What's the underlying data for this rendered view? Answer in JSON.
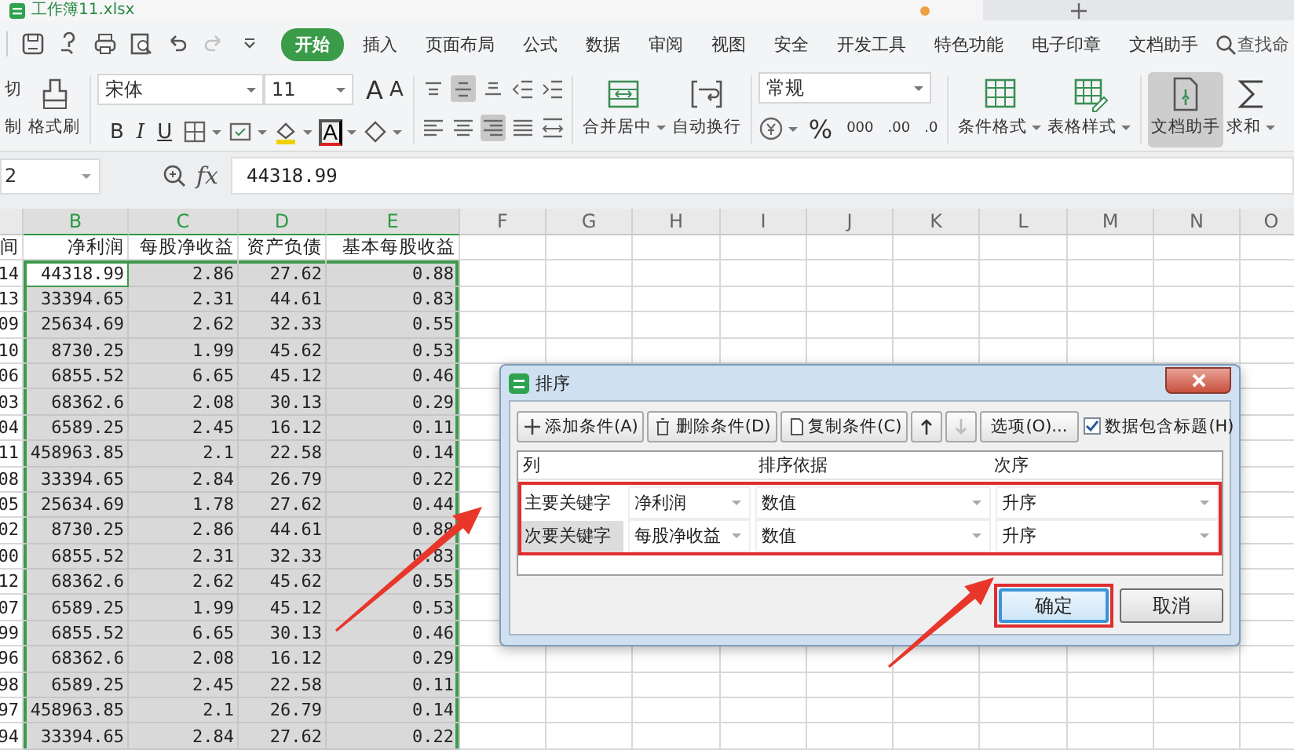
{
  "document_tab": {
    "title": "工作簿11.xlsx",
    "unsaved": true
  },
  "quick_access": [
    {
      "kind": "save",
      "disabled": false
    },
    {
      "kind": "format",
      "disabled": false
    },
    {
      "kind": "print",
      "disabled": false
    },
    {
      "kind": "preview",
      "disabled": false
    },
    {
      "kind": "undo",
      "disabled": false
    },
    {
      "kind": "redo",
      "disabled": true
    },
    {
      "kind": "customize",
      "disabled": false
    }
  ],
  "menu": {
    "tabs": [
      {
        "label": "开始",
        "selected": true
      },
      {
        "label": "插入",
        "selected": false
      },
      {
        "label": "页面布局",
        "selected": false
      },
      {
        "label": "公式",
        "selected": false
      },
      {
        "label": "数据",
        "selected": false
      },
      {
        "label": "审阅",
        "selected": false
      },
      {
        "label": "视图",
        "selected": false
      },
      {
        "label": "安全",
        "selected": false
      },
      {
        "label": "开发工具",
        "selected": false
      },
      {
        "label": "特色功能",
        "selected": false
      },
      {
        "label": "电子印章",
        "selected": false
      },
      {
        "label": "文档助手",
        "selected": false
      }
    ],
    "search": "查找命"
  },
  "ribbon": {
    "clipboard": {
      "cut": "切",
      "copy": "制",
      "format_painter": "格式刷"
    },
    "font": {
      "name": "宋体",
      "size": "11",
      "grow": "A",
      "shrink": "A",
      "bold": "B",
      "italic": "I",
      "underline": "U",
      "font_color": "A"
    },
    "alignment": [
      {
        "kind": "top",
        "selected": false
      },
      {
        "kind": "middle",
        "selected": true
      },
      {
        "kind": "bottom",
        "selected": false
      },
      {
        "kind": "outdent",
        "selected": false
      },
      {
        "kind": "indent",
        "selected": false
      },
      {
        "kind": "left",
        "selected": false
      },
      {
        "kind": "center",
        "selected": false
      },
      {
        "kind": "right",
        "selected": true
      },
      {
        "kind": "justify",
        "selected": false
      },
      {
        "kind": "distributed",
        "selected": false
      }
    ],
    "merge": "合并居中",
    "wrap": "自动换行",
    "number": {
      "format": "常规",
      "percent": "%",
      "thousands": "000",
      "increase_decimal": ".00",
      "decrease_decimal": ".0"
    },
    "tools": [
      {
        "kind": "conditional",
        "label": "条件格式",
        "dropdown": true,
        "selected": false
      },
      {
        "kind": "table-style",
        "label": "表格样式",
        "dropdown": true,
        "selected": false
      },
      {
        "kind": "assistant",
        "label": "文档助手",
        "dropdown": false,
        "selected": true
      },
      {
        "kind": "sum",
        "label": "求和",
        "dropdown": true,
        "selected": false
      }
    ]
  },
  "formula_bar": {
    "cell": "2",
    "fx": "fx",
    "value": "44318.99"
  },
  "sheet": {
    "columns": [
      {
        "selected": false
      },
      {
        "label": "B",
        "selected": true
      },
      {
        "label": "C",
        "selected": true
      },
      {
        "label": "D",
        "selected": true
      },
      {
        "label": "E",
        "selected": true
      },
      {
        "label": "F",
        "selected": false
      },
      {
        "label": "G",
        "selected": false
      },
      {
        "label": "H",
        "selected": false
      },
      {
        "label": "I",
        "selected": false
      },
      {
        "label": "J",
        "selected": false
      },
      {
        "label": "K",
        "selected": false
      },
      {
        "label": "L",
        "selected": false
      },
      {
        "label": "M",
        "selected": false
      },
      {
        "label": "N",
        "selected": false
      },
      {
        "label": "O",
        "selected": false
      }
    ],
    "rows": [
      {
        "cells": [
          "间",
          "净利润",
          "每股净收益",
          "资产负债",
          "基本每股收益"
        ],
        "selected": false,
        "active": false
      },
      {
        "cells": [
          "14",
          "44318.99",
          "2.86",
          "27.62",
          "0.88"
        ],
        "selected": true,
        "active": true
      },
      {
        "cells": [
          "13",
          "33394.65",
          "2.31",
          "44.61",
          "0.83"
        ],
        "selected": true,
        "active": false
      },
      {
        "cells": [
          "09",
          "25634.69",
          "2.62",
          "32.33",
          "0.55"
        ],
        "selected": true,
        "active": false
      },
      {
        "cells": [
          "10",
          "8730.25",
          "1.99",
          "45.62",
          "0.53"
        ],
        "selected": true,
        "active": false
      },
      {
        "cells": [
          "06",
          "6855.52",
          "6.65",
          "45.12",
          "0.46"
        ],
        "selected": true,
        "active": false
      },
      {
        "cells": [
          "03",
          "68362.6",
          "2.08",
          "30.13",
          "0.29"
        ],
        "selected": true,
        "active": false
      },
      {
        "cells": [
          "04",
          "6589.25",
          "2.45",
          "16.12",
          "0.11"
        ],
        "selected": true,
        "active": false
      },
      {
        "cells": [
          "11",
          "458963.85",
          "2.1",
          "22.58",
          "0.14"
        ],
        "selected": true,
        "active": false
      },
      {
        "cells": [
          "08",
          "33394.65",
          "2.84",
          "26.79",
          "0.22"
        ],
        "selected": true,
        "active": false
      },
      {
        "cells": [
          "05",
          "25634.69",
          "1.78",
          "27.62",
          "0.44"
        ],
        "selected": true,
        "active": false
      },
      {
        "cells": [
          "02",
          "8730.25",
          "2.86",
          "44.61",
          "0.88"
        ],
        "selected": true,
        "active": false
      },
      {
        "cells": [
          "00",
          "6855.52",
          "2.31",
          "32.33",
          "0.83"
        ],
        "selected": true,
        "active": false
      },
      {
        "cells": [
          "12",
          "68362.6",
          "2.62",
          "45.62",
          "0.55"
        ],
        "selected": true,
        "active": false
      },
      {
        "cells": [
          "07",
          "6589.25",
          "1.99",
          "45.12",
          "0.53"
        ],
        "selected": true,
        "active": false
      },
      {
        "cells": [
          "99",
          "6855.52",
          "6.65",
          "30.13",
          "0.46"
        ],
        "selected": true,
        "active": false
      },
      {
        "cells": [
          "96",
          "68362.6",
          "2.08",
          "16.12",
          "0.29"
        ],
        "selected": true,
        "active": false
      },
      {
        "cells": [
          "98",
          "6589.25",
          "2.45",
          "22.58",
          "0.11"
        ],
        "selected": true,
        "active": false
      },
      {
        "cells": [
          "97",
          "458963.85",
          "2.1",
          "26.79",
          "0.14"
        ],
        "selected": true,
        "active": false
      },
      {
        "cells": [
          "94",
          "33394.65",
          "2.84",
          "27.62",
          "0.22"
        ],
        "selected": true,
        "active": false
      }
    ]
  },
  "dialog": {
    "title": "排序",
    "toolbar": [
      {
        "kind": "add",
        "label": "添加条件(A)",
        "disabled": false
      },
      {
        "kind": "delete",
        "label": "删除条件(D)",
        "disabled": false
      },
      {
        "kind": "copy",
        "label": "复制条件(C)",
        "disabled": false
      },
      {
        "kind": "up",
        "disabled": false
      },
      {
        "kind": "down",
        "disabled": true
      },
      {
        "kind": "options",
        "label": "选项(O)...",
        "disabled": false
      }
    ],
    "header_checkbox": {
      "label": "数据包含标题(H)",
      "checked": true
    },
    "columns": [
      "列",
      "排序依据",
      "次序"
    ],
    "rows": [
      {
        "label": "主要关键字",
        "column": "净利润",
        "basis": "数值",
        "order": "升序",
        "selected": false
      },
      {
        "label": "次要关键字",
        "column": "每股净收益",
        "basis": "数值",
        "order": "升序",
        "selected": true
      }
    ],
    "buttons": [
      {
        "label": "确定",
        "default": true
      },
      {
        "label": "取消",
        "default": false
      }
    ]
  }
}
